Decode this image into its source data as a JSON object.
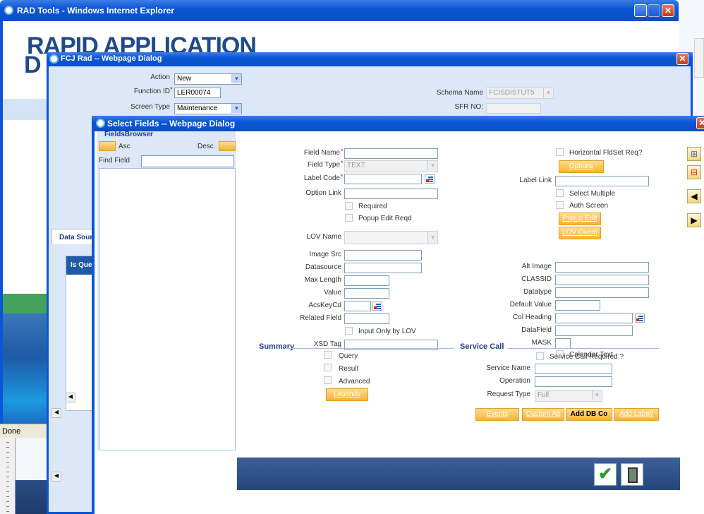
{
  "ie_window": {
    "title": "RAD Tools - Windows Internet Explorer",
    "banner_line1": "RAPID APPLICATION",
    "banner_line2": "D",
    "status": "Done"
  },
  "fcj_dialog": {
    "title": "FCJ Rad -- Webpage Dialog",
    "action_label": "Action",
    "action_value": "New",
    "function_id_label": "Function ID",
    "function_id_value": "LER00074",
    "screen_type_label": "Screen Type",
    "screen_type_value": "Maintenance",
    "schema_name_label": "Schema Name",
    "schema_name_value": "FCISDISTUT5",
    "sfr_no_label": "SFR NO:",
    "tab_label": "Data Sour",
    "column_header": "Is Que"
  },
  "select_dialog": {
    "title": "Select Fields -- Webpage Dialog"
  },
  "fields_browser": {
    "title": "FieldsBrowser",
    "asc_label": "Asc",
    "desc_label": "Desc",
    "find_field_label": "Find Field",
    "find_field_value": ""
  },
  "form": {
    "field_name_label": "Field Name",
    "field_type_label": "Field Type",
    "field_type_value": "TEXT",
    "label_code_label": "Label Code",
    "option_link_label": "Option Link",
    "required_label": "Required",
    "popup_edit_reqd_label": "Popup Edit Reqd",
    "lov_name_label": "LOV Name",
    "image_src_label": "Image Src",
    "datasource_label": "Datasource",
    "max_length_label": "Max Length",
    "value_label": "Value",
    "acskeycd_label": "AcsKeyCd",
    "related_field_label": "Related Field",
    "input_only_by_lov_label": "Input Only by LOV",
    "xsd_tag_label": "XSD Tag",
    "horizontal_fldset_label": "Horizontal FldSet Req?",
    "options_button": "Options",
    "label_link_label": "Label Link",
    "select_multiple_label": "Select Multiple",
    "auth_screen_label": "Auth Screen",
    "popup_edit_button": "Popup Edit",
    "lov_overri_button": "LOV Overri",
    "alt_image_label": "Alt Image",
    "classid_label": "CLASSID",
    "datatype_label": "Datatype",
    "default_value_label": "Default Value",
    "col_heading_label": "Col Heading",
    "datafield_label": "DataField",
    "mask_label": "MASK",
    "calendar_text_label": "Calendar Text"
  },
  "summary": {
    "title": "Summary",
    "query_label": "Query",
    "result_label": "Result",
    "advanced_label": "Advanced",
    "legends_button": "Legends"
  },
  "service_call": {
    "title": "Service Call",
    "required_label": "Service Call Required ?",
    "service_name_label": "Service Name",
    "operation_label": "Operation",
    "request_type_label": "Request Type",
    "request_type_value": "Full"
  },
  "bottom_buttons": {
    "events": "Events",
    "custom_att": "Custom Att",
    "add_db_co": "Add DB Co",
    "add_label": "Add Label/"
  },
  "colors": {
    "accent": "#0a56d6",
    "button_orange": "#f7b236",
    "bottom_bar": "#2c4e84"
  }
}
